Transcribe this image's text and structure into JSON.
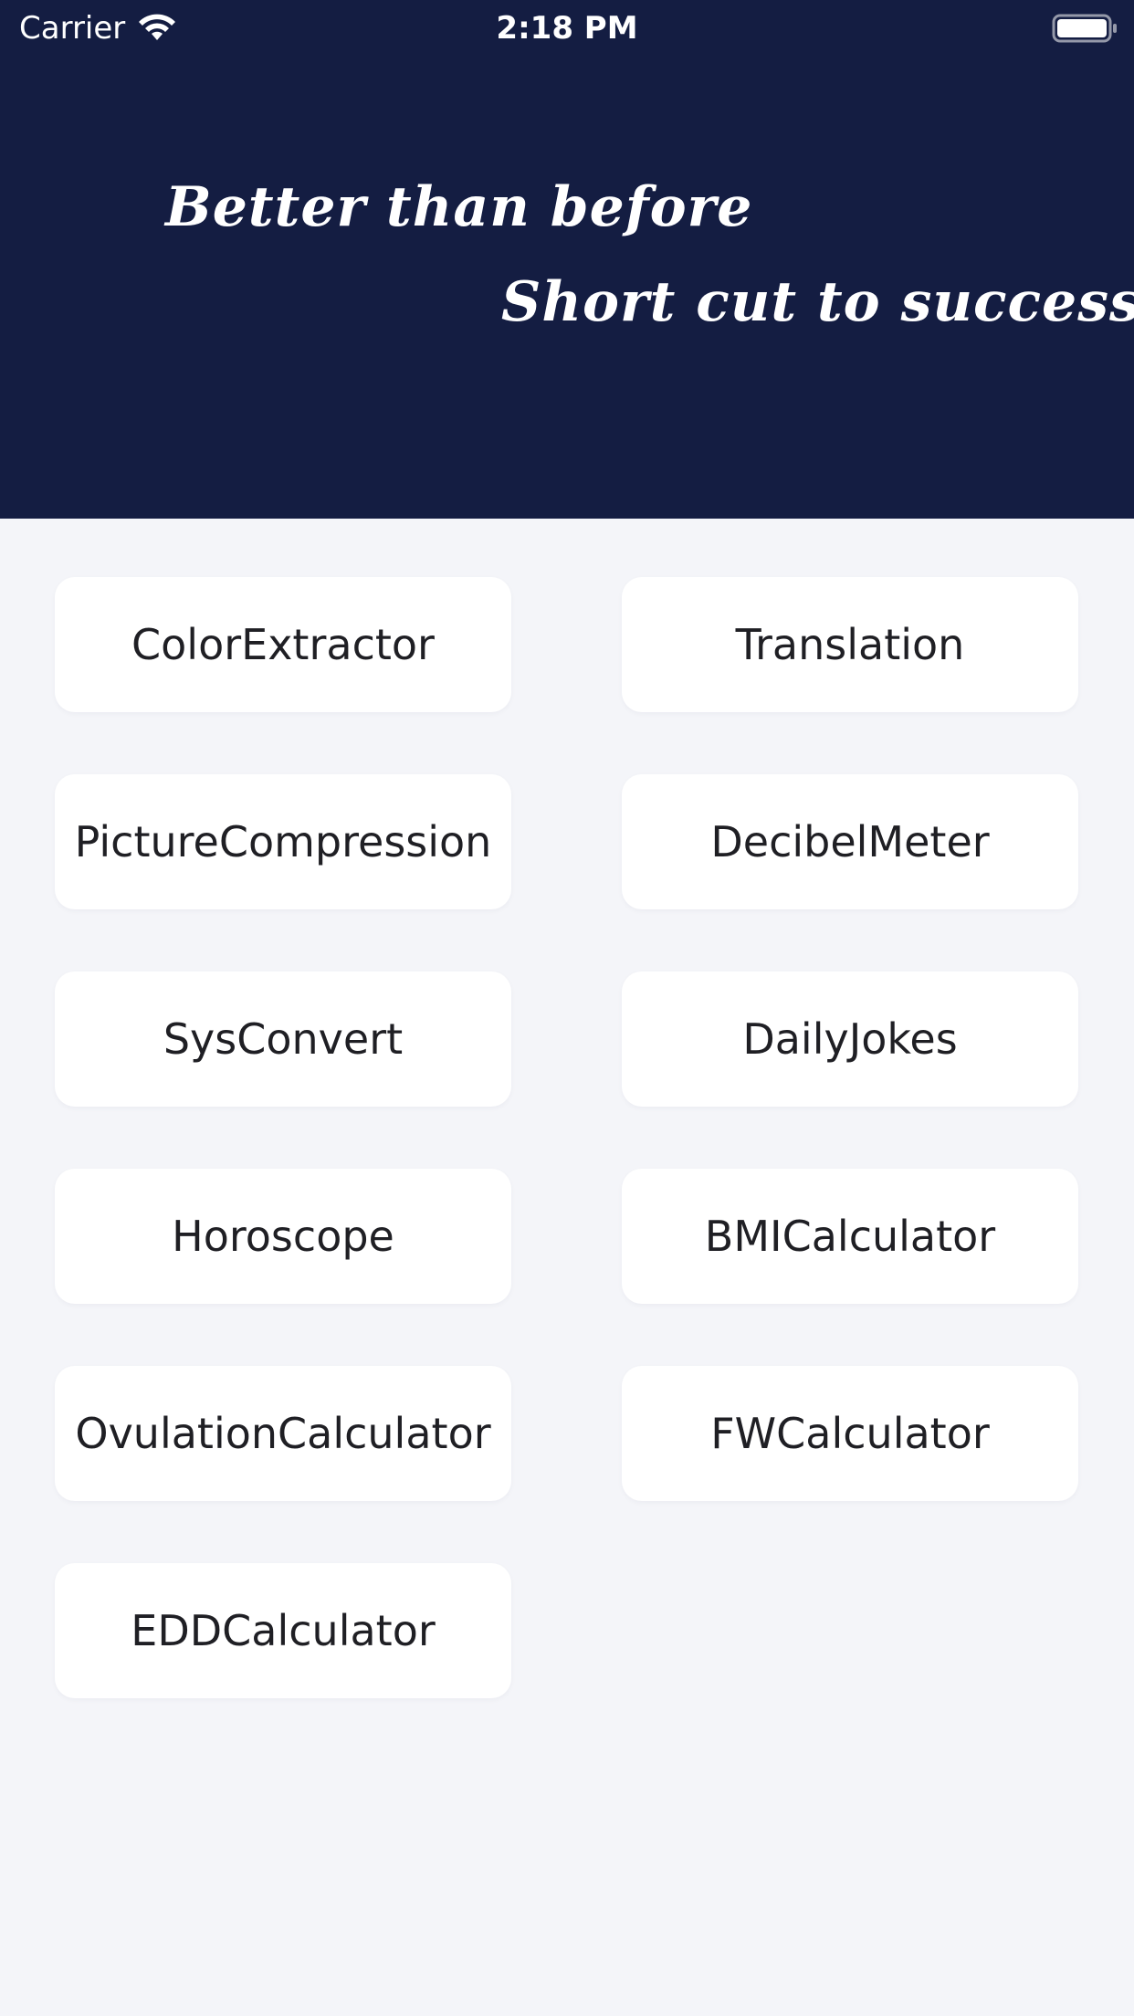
{
  "status_bar": {
    "carrier": "Carrier",
    "time": "2:18 PM",
    "icons": [
      "wifi-icon",
      "battery-icon"
    ]
  },
  "header": {
    "background_color": "#141d42",
    "slogan_line1": "Better than before",
    "slogan_line2": "Short cut to success"
  },
  "tools": [
    {
      "label": "ColorExtractor"
    },
    {
      "label": "Translation"
    },
    {
      "label": "PictureCompression"
    },
    {
      "label": "DecibelMeter"
    },
    {
      "label": "SysConvert"
    },
    {
      "label": "DailyJokes"
    },
    {
      "label": "Horoscope"
    },
    {
      "label": "BMICalculator"
    },
    {
      "label": "OvulationCalculator"
    },
    {
      "label": "FWCalculator"
    },
    {
      "label": "EDDCalculator"
    }
  ],
  "colors": {
    "page_background": "#f4f5f9",
    "tile_background": "#ffffff",
    "tile_text": "#1f1f24"
  }
}
